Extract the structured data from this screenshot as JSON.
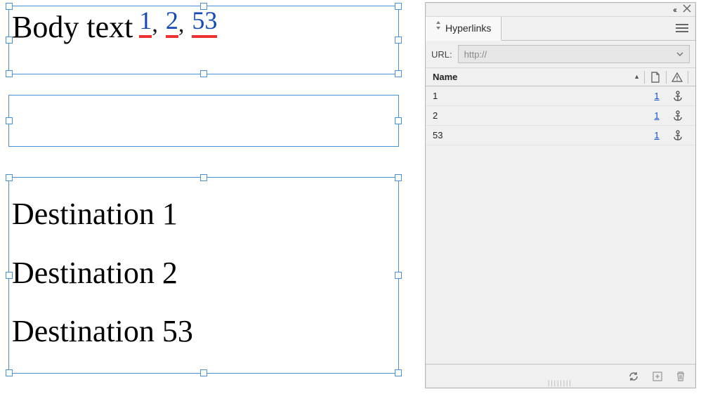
{
  "canvas": {
    "body_text": "Body text",
    "superscript_links": [
      {
        "label": "1"
      },
      {
        "label": "2"
      },
      {
        "label": "53"
      }
    ],
    "destinations": [
      "Destination 1",
      "Destination 2",
      "Destination 53"
    ]
  },
  "panel": {
    "tabs": {
      "hyperlinks": "Hyperlinks"
    },
    "url_label": "URL:",
    "url_placeholder": "http://",
    "header_name": "Name",
    "rows": [
      {
        "name": "1",
        "page": "1"
      },
      {
        "name": "2",
        "page": "1"
      },
      {
        "name": "53",
        "page": "1"
      }
    ]
  }
}
